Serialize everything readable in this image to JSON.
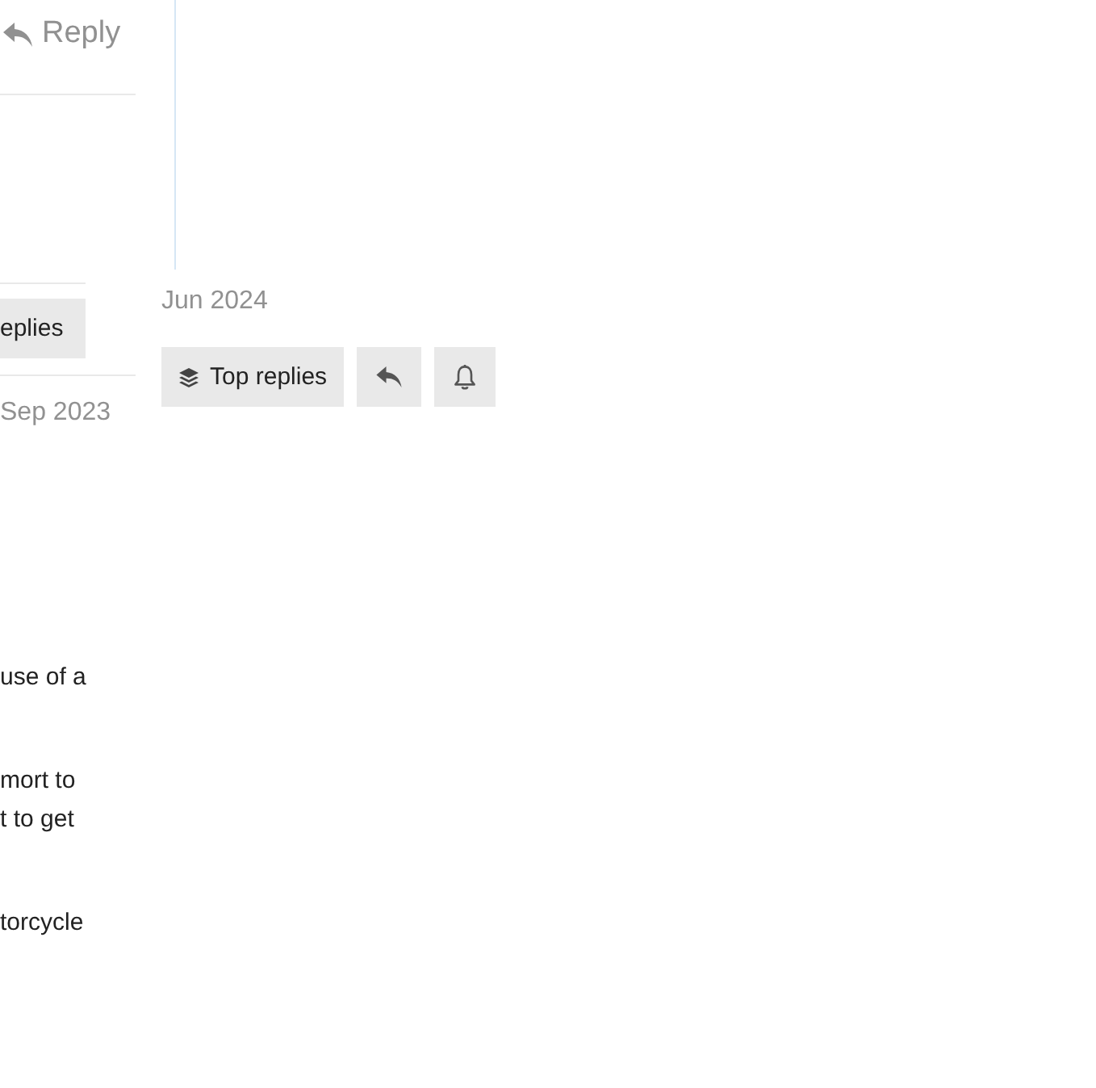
{
  "post_header": {
    "reply_link": "Reply"
  },
  "replies_button": {
    "label": "eplies"
  },
  "post_date": "Sep 2023",
  "post_body": {
    "paragraphs": [
      [
        "use of a"
      ],
      [
        "mort to",
        "t to get"
      ],
      [
        "torcycle"
      ]
    ]
  },
  "timeline": {
    "end_date": "Jun 2024"
  },
  "timeline_controls": [
    {
      "kind": "top_replies",
      "label": "Top replies"
    },
    {
      "kind": "reply"
    },
    {
      "kind": "notifications"
    }
  ]
}
